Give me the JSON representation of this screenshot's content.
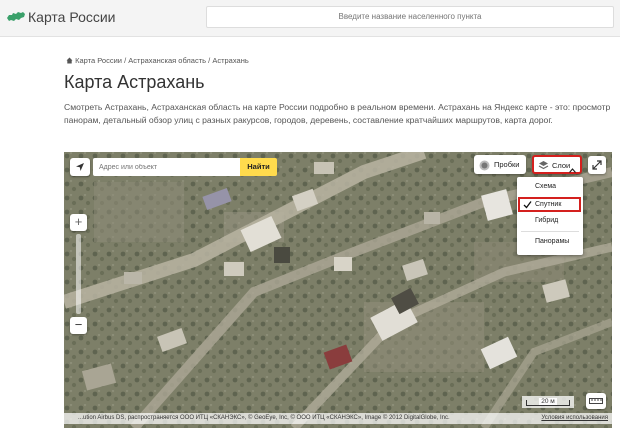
{
  "header": {
    "logo_text": "Карта России",
    "search_placeholder": "Введите название населенного пункта"
  },
  "breadcrumb": {
    "items": [
      "Карта России",
      "Астраханская область",
      "Астрахань"
    ],
    "separator": "/"
  },
  "page": {
    "title": "Карта Астрахань",
    "description": "Смотреть Астрахань, Астраханская область на карте России подробно в реальном времени. Астрахань на Яндекс карте - это: просмотр панорам, детальный обзор улиц с разных ракурсов, городов, деревень, составление кратчайших маршрутов, карта дорог."
  },
  "map": {
    "search_placeholder": "Адрес или объект",
    "find_label": "Найти",
    "traffic_label": "Пробки",
    "layers_label": "Слои",
    "layers_menu": {
      "schema": "Схема",
      "sputnik": "Спутник",
      "hybrid": "Гибрид",
      "panoramas": "Панорамы",
      "selected": "Спутник"
    },
    "zoom_in": "+",
    "zoom_out": "−",
    "scale_label": "20 м",
    "copyright": "...ution Airbus DS, распространяется ООО ИТЦ «СКАНЭКС», © GeoEye, Inc, © ООО ИТЦ «СКАНЭКС», Image © 2012 DigitalGlobe, Inc.",
    "terms_label": "Условия использования"
  },
  "colors": {
    "find_button": "#ffdb4d",
    "highlight": "#d4201e",
    "header_bg": "#f4f4f4"
  }
}
